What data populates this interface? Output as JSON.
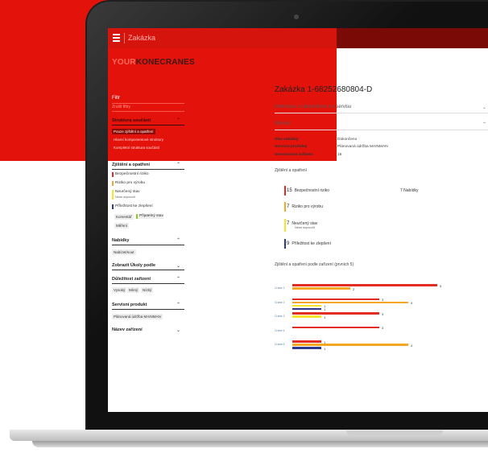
{
  "colors": {
    "brand_red": "#e3120b",
    "safety_risk": "#e32c22",
    "production_risk": "#f5a623",
    "uncertain": "#f5e52b",
    "opportunity": "#2d3a8c",
    "accepted": "#8bcc2b"
  },
  "topbar": {
    "menu_icon": "hamburger-menu-icon",
    "title": "Zakázka"
  },
  "logo": {
    "prefix": "YOUR",
    "brand": "KONECRANES"
  },
  "sidebar": {
    "filter_title": "Filtr",
    "filter_sub": "Zrušit filtry",
    "structure": {
      "title": "Struktura součástí",
      "items": [
        "Pouze zjištění a opatření",
        "Hlavní komponentové struktury",
        "Kompletní struktura součástí"
      ],
      "selected": 0
    },
    "findings": {
      "title": "Zjištění a opatření",
      "items": [
        {
          "label": "Bezpečnostní riziko",
          "color": "#e32c22"
        },
        {
          "label": "Riziko pro výrobu",
          "color": "#f5a623"
        },
        {
          "label": "Neurčený stav",
          "sub": "Nelze doporučit",
          "color": "#f5e52b"
        },
        {
          "label": "Příležitost ke zlepšení",
          "color": "#2d3a8c"
        }
      ],
      "chips": [
        "Komentář",
        "Přijatelný stav",
        "Měření"
      ]
    },
    "offers": {
      "title": "Nabídky",
      "chip": "Nabízet/nout"
    },
    "show_tasks": {
      "title": "Zobrazit Úkoly podle"
    },
    "importance": {
      "title": "Důležitost zařízení",
      "chips": [
        "Vysoký",
        "Mírný",
        "Nízký"
      ]
    },
    "service_product": {
      "title": "Servisní produkt",
      "chip": "Plánovaná údržba MAINMAN"
    },
    "device_name": {
      "title": "Název zařízení"
    }
  },
  "main": {
    "title": "Zakázka 1-68252680804-D",
    "customer_info": "Informace o zákazníkovi a o servisu",
    "summary": "Shrnutí",
    "kv": [
      {
        "label": "Stav zakázky",
        "value": "Dokončeno"
      },
      {
        "label": "Servisní produkty",
        "value": "Plánovaná údržba MAINMAN"
      },
      {
        "label": "Servisovaná zařízení",
        "value": "16"
      }
    ],
    "findings_head": "Zjištění a opatření",
    "findings": [
      {
        "count": "15",
        "label": "Bezpečnostní riziko",
        "extra": "7 Nabídky",
        "color": "#e32c22"
      },
      {
        "count": "7",
        "label": "Riziko pro výrobu",
        "color": "#f5a623"
      },
      {
        "count": "7",
        "label": "Neurčený stav",
        "sub": "Nelze doporučit",
        "color": "#f5e52b"
      },
      {
        "count": "9",
        "label": "Příležitost ke zlepšení",
        "color": "#2d3a8c"
      }
    ],
    "chart_head": "Zjištění a opatření podle zařízení (prvních 5)"
  },
  "chart_data": {
    "type": "bar",
    "title": "Zjištění a opatření podle zařízení (prvních 5)",
    "categories": [
      "Crane 1",
      "Crane 2",
      "Crane 3",
      "Crane 4",
      "Crane 5"
    ],
    "series": [
      {
        "name": "Bezpečnostní riziko",
        "color": "#e32c22",
        "values": [
          5,
          3,
          3,
          3,
          1
        ]
      },
      {
        "name": "Riziko pro výrobu",
        "color": "#f5a623",
        "values": [
          2,
          4,
          0,
          0,
          4
        ]
      },
      {
        "name": "Neurčený stav",
        "color": "#f5e52b",
        "values": [
          0,
          1,
          1,
          0,
          0
        ]
      },
      {
        "name": "Příležitost ke zlepšení",
        "color": "#2d3a8c",
        "values": [
          0,
          1,
          0,
          0,
          1
        ]
      }
    ],
    "labels": [
      [
        "5",
        "2"
      ],
      [
        "4",
        "1",
        "1"
      ],
      [
        "3",
        "1"
      ],
      [
        "3"
      ],
      [
        "1",
        "4"
      ]
    ]
  }
}
